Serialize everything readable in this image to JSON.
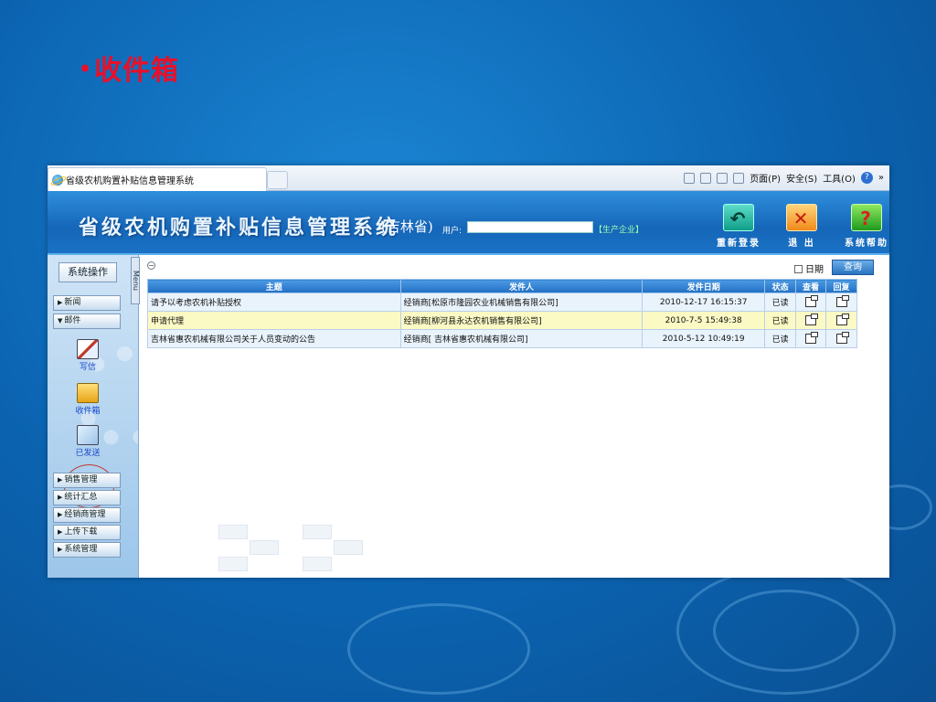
{
  "slide": {
    "bullet": "•",
    "title": "收件箱"
  },
  "browser": {
    "tab_title": "省级农机购置补贴信息管理系统",
    "tools": [
      "页面(P)",
      "安全(S)",
      "工具(O)"
    ],
    "more": "»"
  },
  "header": {
    "system_title": "省级农机购置补贴信息管理系统",
    "province": "(吉林省)",
    "user_label": "用户:",
    "user_value": "",
    "company_tag": "【生产企业】",
    "buttons": [
      {
        "label": "重新登录",
        "icon": "refresh-icon"
      },
      {
        "label": "退 出",
        "icon": "exit-icon"
      },
      {
        "label": "系统帮助",
        "icon": "help-icon"
      }
    ]
  },
  "sidebar": {
    "sys_op": "系统操作",
    "menu_label": "Menu",
    "items_top": [
      "新闻",
      "邮件"
    ],
    "mail_icons": [
      "写信",
      "收件箱",
      "已发送"
    ],
    "items_bottom": [
      "销售管理",
      "统计汇总",
      "经销商管理",
      "上传下载",
      "系统管理"
    ]
  },
  "toolbar": {
    "date_label": "日期",
    "query_label": "查询"
  },
  "table": {
    "headers": [
      "主题",
      "发件人",
      "发件日期",
      "状态",
      "查看",
      "回复"
    ],
    "rows": [
      {
        "subject": "请予以考虑农机补贴授权",
        "sender": "经销商[松原市隆园农业机械销售有限公司]",
        "date": "2010-12-17 16:15:37",
        "status": "已读"
      },
      {
        "subject": "申请代理",
        "sender": "经销商[柳河县永达农机销售有限公司]",
        "date": "2010-7-5 15:49:38",
        "status": "已读"
      },
      {
        "subject": "吉林省惠农机械有限公司关于人员变动的公告",
        "sender": "经销商[ 吉林省惠农机械有限公司]",
        "date": "2010-5-12 10:49:19",
        "status": "已读"
      }
    ]
  },
  "colors": {
    "accent": "#2a73c0",
    "title_red": "#e8102a",
    "highlight_row": "#fbf9c4"
  }
}
